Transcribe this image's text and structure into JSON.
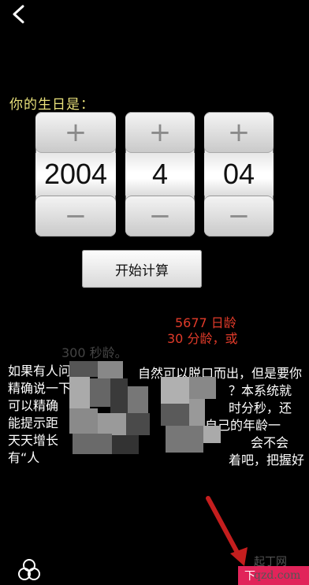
{
  "nav": {
    "back_icon": "chevron-left-icon"
  },
  "birthday": {
    "label": "你的生日是：",
    "plus_symbol": "+",
    "minus_symbol": "−",
    "year": "2004",
    "month": "4",
    "day": "04"
  },
  "calc_button": {
    "label": "开始计算"
  },
  "result": {
    "line1_visible": "5677 日龄",
    "line2_visible": "30 分龄，或",
    "line3_visible": "300 秒龄。"
  },
  "description": {
    "lines": [
      "如果有人问",
      "精确说一下",
      "可以精确",
      "能提示距",
      "天天增长",
      "有“人"
    ],
    "right_fragments": [
      "自然可以脱口而出，但是要你",
      "？本系统就",
      "时分秒，还",
      "自己的年龄一",
      "会不会",
      "着吧，把握好"
    ]
  },
  "footer": {
    "app_icon": "triple-circle-icon",
    "next_label": "下",
    "watermark": "起丁网 qzd.com"
  },
  "colors": {
    "accent": "#e1245a",
    "label": "#e8e07a",
    "result": "#e23b2a"
  }
}
